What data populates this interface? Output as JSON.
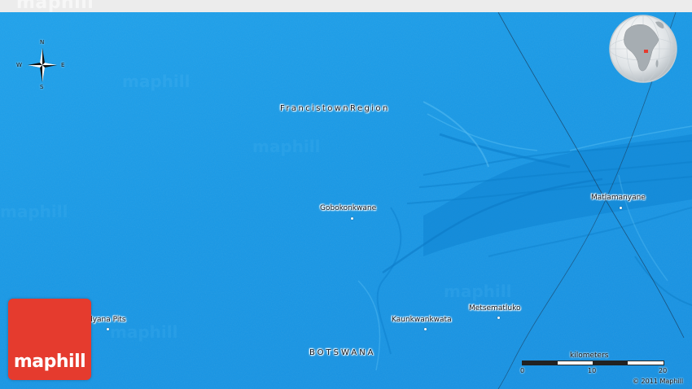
{
  "header": {
    "watermark": "maphill"
  },
  "map": {
    "background_color": "#1a9ae8",
    "region_label": "FrancistownRegion",
    "country_label": "BOTSWANA",
    "places": [
      {
        "name": "Gobokonkwane"
      },
      {
        "name": "Matlamanyane"
      },
      {
        "name": "Metsematluko"
      },
      {
        "name": "Kaunkwankwata"
      },
      {
        "name": "dyana Pits"
      }
    ]
  },
  "compass": {
    "north": "N",
    "south": "S",
    "east": "E",
    "west": "W"
  },
  "globe": {
    "highlight_color": "#e53b2e"
  },
  "logo": {
    "text": "maphill",
    "color": "#e53b2e"
  },
  "scale": {
    "unit_label": "kilometers",
    "ticks": [
      "0",
      "10",
      "20"
    ]
  },
  "copyright": "© 2011 Maphill"
}
